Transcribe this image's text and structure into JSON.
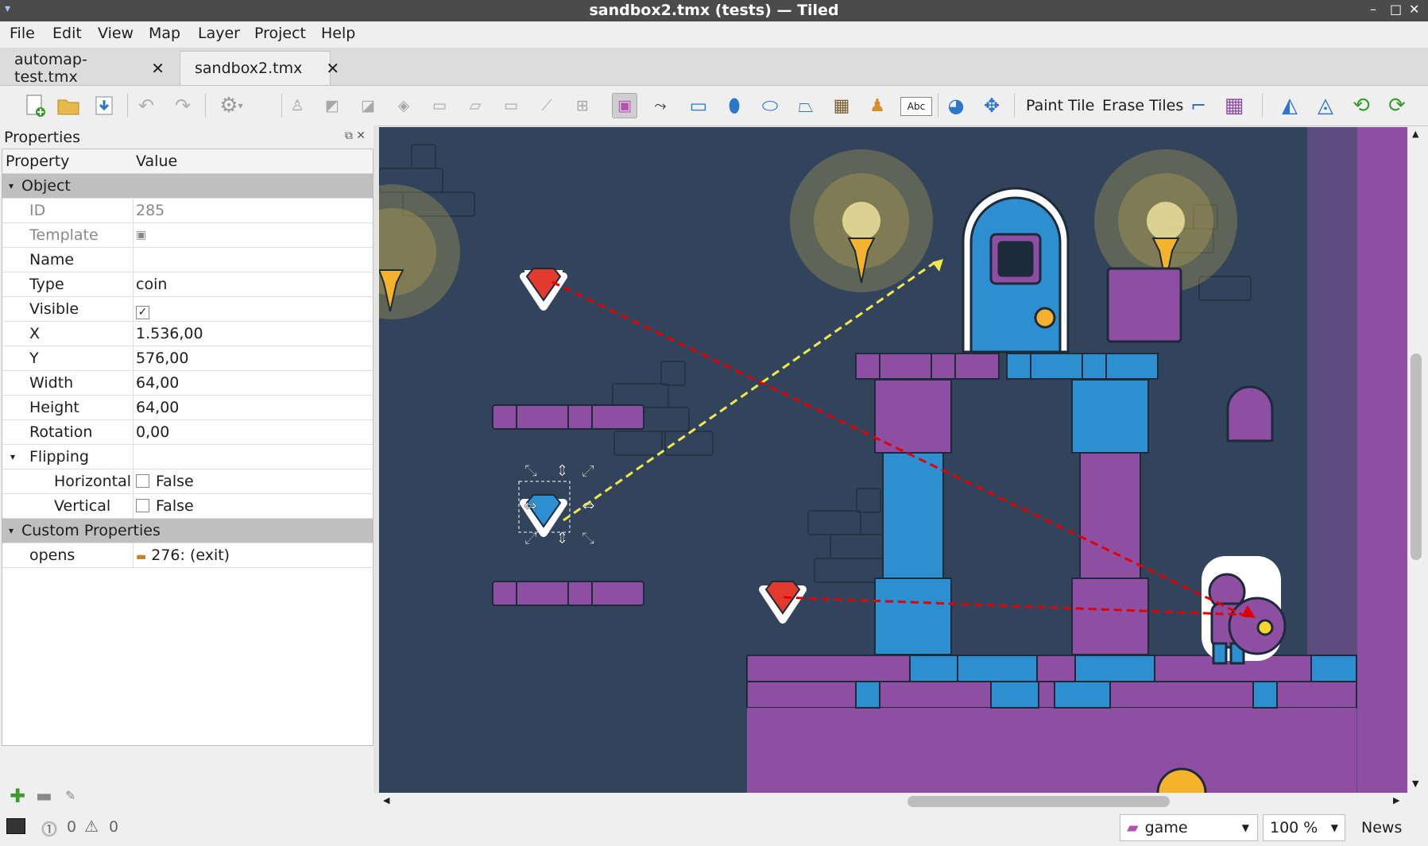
{
  "window": {
    "title": "sandbox2.tmx (tests) — Tiled"
  },
  "menu": [
    "File",
    "Edit",
    "View",
    "Map",
    "Layer",
    "Project",
    "Help"
  ],
  "tabs": [
    {
      "label": "automap-test.tmx",
      "active": false
    },
    {
      "label": "sandbox2.tmx",
      "active": true
    }
  ],
  "toolbar": {
    "paint_tile": "Paint Tile",
    "erase_tiles": "Erase Tiles",
    "text_tool_icon": "Abc"
  },
  "properties": {
    "title": "Properties",
    "col_property": "Property",
    "col_value": "Value",
    "group_object": "Object",
    "id_label": "ID",
    "id_value": "285",
    "template_label": "Template",
    "name_label": "Name",
    "name_value": "",
    "type_label": "Type",
    "type_value": "coin",
    "visible_label": "Visible",
    "visible_value": "✓",
    "x_label": "X",
    "x_value": "1.536,00",
    "y_label": "Y",
    "y_value": "576,00",
    "width_label": "Width",
    "width_value": "64,00",
    "height_label": "Height",
    "height_value": "64,00",
    "rotation_label": "Rotation",
    "rotation_value": "0,00",
    "flipping_label": "Flipping",
    "horizontal_label": "Horizontal",
    "horizontal_value": "False",
    "vertical_label": "Vertical",
    "vertical_value": "False",
    "group_custom": "Custom Properties",
    "opens_label": "opens",
    "opens_value": "276: (exit)"
  },
  "status": {
    "errors": "0",
    "warnings": "0",
    "layer": "game",
    "zoom": "100 %",
    "news": "News"
  },
  "colors": {
    "map_bg": "#32445c",
    "purple": "#8e4fa3",
    "blue": "#2d8fd0",
    "gem_red": "#e23b2e",
    "link_red": "#e00000",
    "link_yellow": "#f3e84a"
  }
}
